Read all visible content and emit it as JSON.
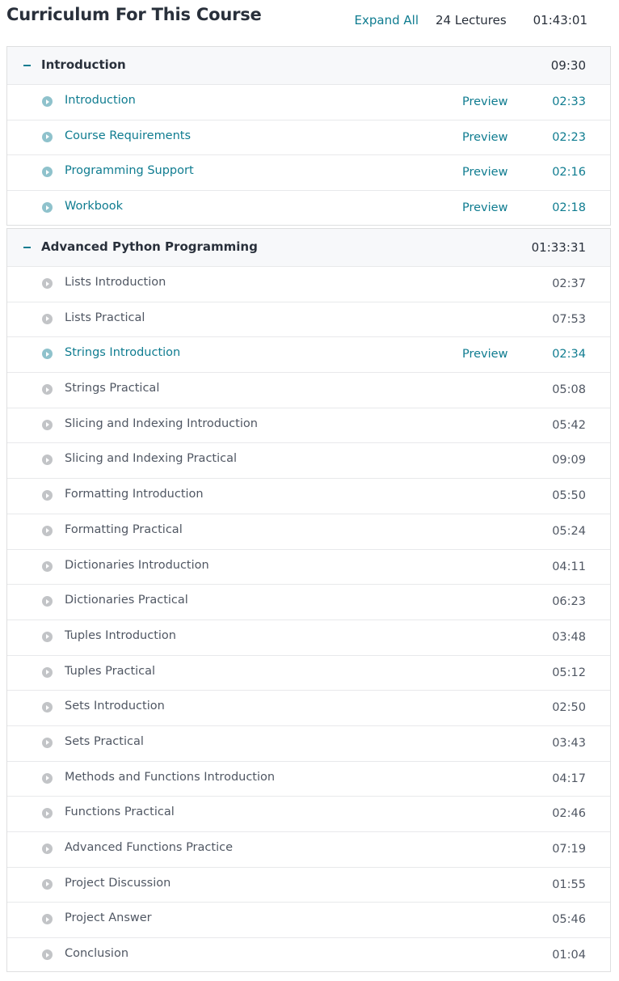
{
  "header": {
    "title": "Curriculum For This Course",
    "expand_all_label": "Expand All",
    "lecture_count": "24 Lectures",
    "total_duration": "01:43:01"
  },
  "colors": {
    "accent": "#0f7c90",
    "text": "#29303b",
    "muted_icon": "#c2c4c7",
    "preview_icon": "#8fc2cc",
    "section_header_bg": "#f7f8fa"
  },
  "icons": {
    "collapse": "minus-icon",
    "lecture": "play-circle-icon"
  },
  "sections": [
    {
      "title": "Introduction",
      "duration": "09:30",
      "lectures": [
        {
          "title": "Introduction",
          "preview": "Preview",
          "duration": "02:33"
        },
        {
          "title": "Course Requirements",
          "preview": "Preview",
          "duration": "02:23"
        },
        {
          "title": "Programming Support",
          "preview": "Preview",
          "duration": "02:16"
        },
        {
          "title": "Workbook",
          "preview": "Preview",
          "duration": "02:18"
        }
      ]
    },
    {
      "title": "Advanced Python Programming",
      "duration": "01:33:31",
      "lectures": [
        {
          "title": "Lists Introduction",
          "preview": "",
          "duration": "02:37"
        },
        {
          "title": "Lists Practical",
          "preview": "",
          "duration": "07:53"
        },
        {
          "title": "Strings Introduction",
          "preview": "Preview",
          "duration": "02:34"
        },
        {
          "title": "Strings Practical",
          "preview": "",
          "duration": "05:08"
        },
        {
          "title": "Slicing and Indexing Introduction",
          "preview": "",
          "duration": "05:42"
        },
        {
          "title": "Slicing and Indexing Practical",
          "preview": "",
          "duration": "09:09"
        },
        {
          "title": "Formatting Introduction",
          "preview": "",
          "duration": "05:50"
        },
        {
          "title": "Formatting Practical",
          "preview": "",
          "duration": "05:24"
        },
        {
          "title": "Dictionaries Introduction",
          "preview": "",
          "duration": "04:11"
        },
        {
          "title": "Dictionaries Practical",
          "preview": "",
          "duration": "06:23"
        },
        {
          "title": "Tuples Introduction",
          "preview": "",
          "duration": "03:48"
        },
        {
          "title": "Tuples Practical",
          "preview": "",
          "duration": "05:12"
        },
        {
          "title": "Sets Introduction",
          "preview": "",
          "duration": "02:50"
        },
        {
          "title": "Sets Practical",
          "preview": "",
          "duration": "03:43"
        },
        {
          "title": "Methods and Functions Introduction",
          "preview": "",
          "duration": "04:17"
        },
        {
          "title": "Functions Practical",
          "preview": "",
          "duration": "02:46"
        },
        {
          "title": "Advanced Functions Practice",
          "preview": "",
          "duration": "07:19"
        },
        {
          "title": "Project Discussion",
          "preview": "",
          "duration": "01:55"
        },
        {
          "title": "Project Answer",
          "preview": "",
          "duration": "05:46"
        },
        {
          "title": "Conclusion",
          "preview": "",
          "duration": "01:04"
        }
      ]
    }
  ]
}
